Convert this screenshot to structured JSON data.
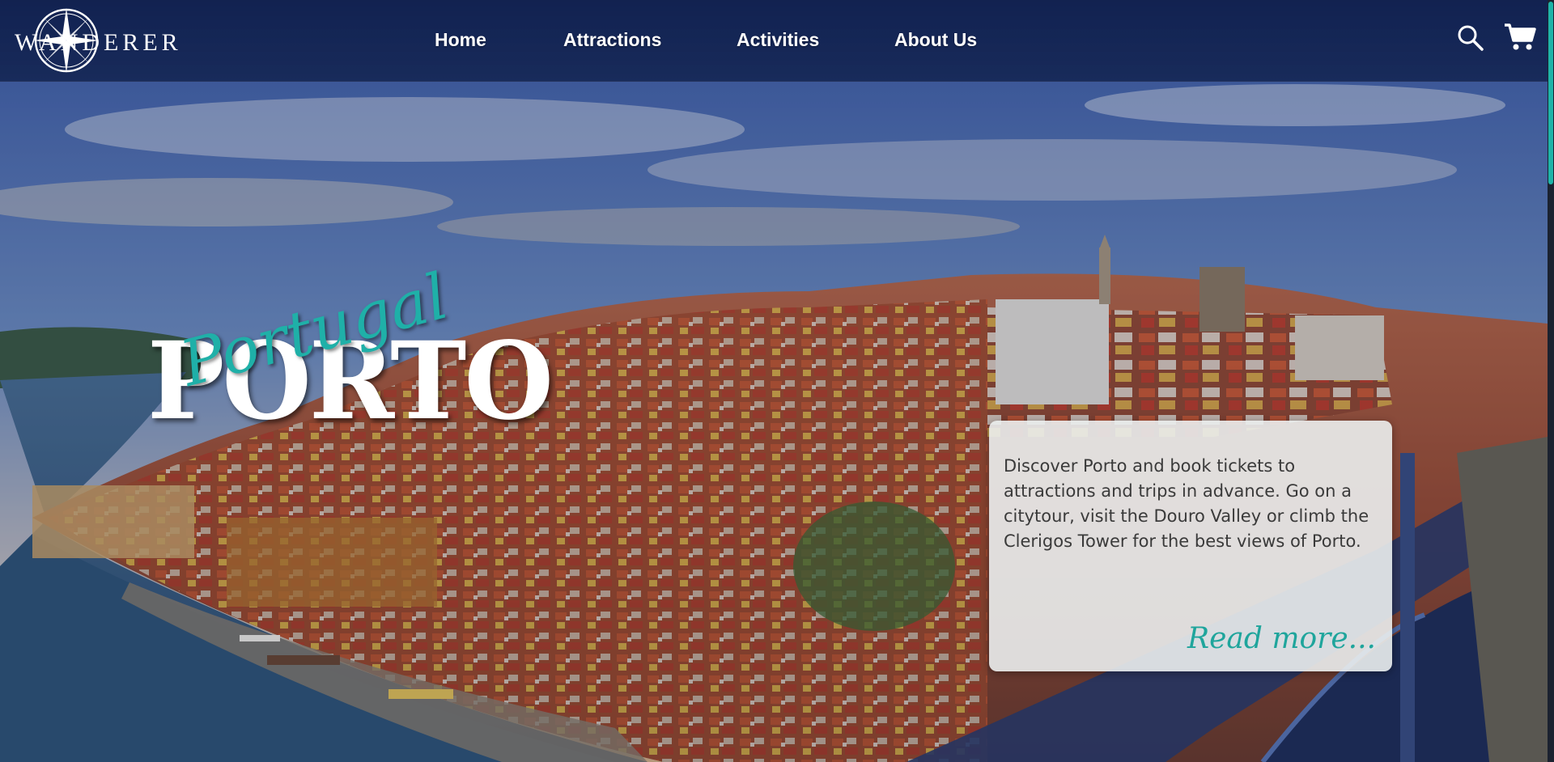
{
  "header": {
    "logo_text": "WANDERER",
    "nav": {
      "home": "Home",
      "attractions": "Attractions",
      "activities": "Activities",
      "about": "About Us"
    }
  },
  "hero": {
    "title": "PORTO",
    "subtitle": "Portugal",
    "card": {
      "text": "Discover Porto and book tickets to attractions and trips in advance. Go on a citytour, visit the Douro Valley or climb the Clerigos Tower for the best views of Porto.",
      "read_more": "Read more..."
    }
  },
  "colors": {
    "nav_bg": "#0f1e4b",
    "accent": "#1fb0a8",
    "card_bg": "#ebeeee"
  }
}
